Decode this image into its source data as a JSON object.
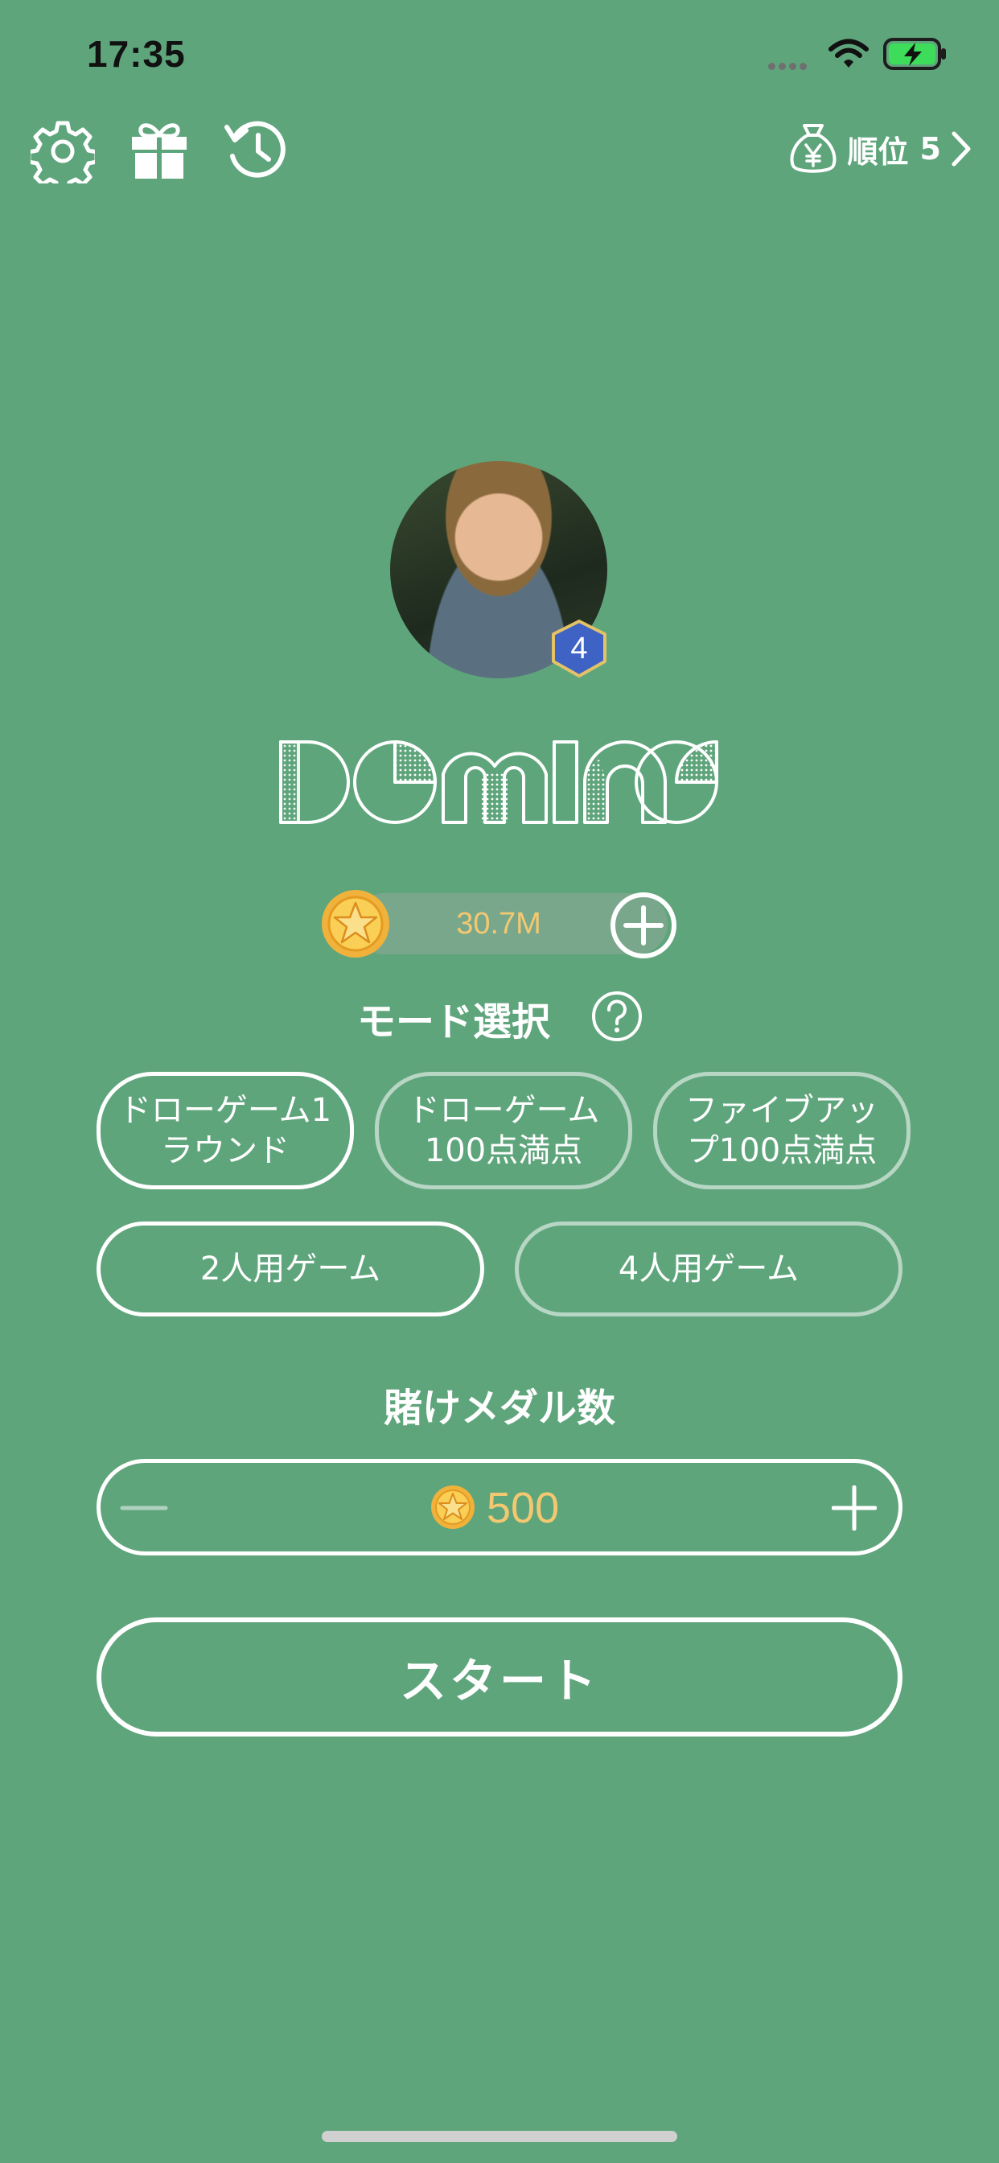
{
  "status_bar": {
    "time": "17:35"
  },
  "header": {
    "settings_icon": "gear-icon",
    "gift_icon": "gift-icon",
    "history_icon": "history-icon",
    "rank_label": "順位",
    "rank_value": "5",
    "rank_icon": "money-bag-yen-icon"
  },
  "profile": {
    "level": "4",
    "logo_text": "DOMINO"
  },
  "wallet": {
    "coins": "30.7M"
  },
  "mode_select": {
    "title": "モード選択",
    "rounds": [
      {
        "label": "ドローゲーム1\nラウンド",
        "selected": true
      },
      {
        "label": "ドローゲーム\n100点満点",
        "selected": false
      },
      {
        "label": "ファイブアッ\nプ100点満点",
        "selected": false
      }
    ],
    "players": [
      {
        "label": "2人用ゲーム",
        "selected": true
      },
      {
        "label": "4人用ゲーム",
        "selected": false
      }
    ]
  },
  "bet": {
    "title": "賭けメダル数",
    "amount": "500"
  },
  "start_label": "スタート",
  "colors": {
    "background": "#5fa57c",
    "coin_gold": "#f3c870",
    "level_badge": "#3f63c4"
  }
}
